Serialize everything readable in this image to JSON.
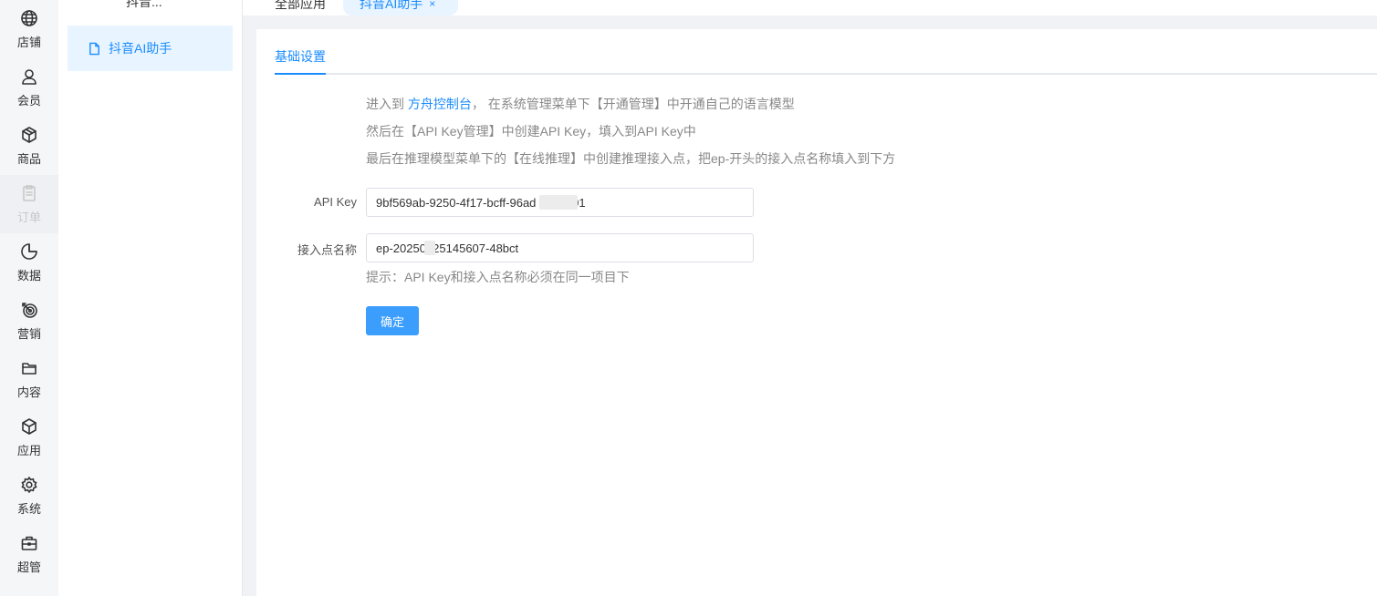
{
  "rail": {
    "items": [
      {
        "label": "店铺",
        "icon": "globe-icon"
      },
      {
        "label": "会员",
        "icon": "user-icon"
      },
      {
        "label": "商品",
        "icon": "box-icon"
      },
      {
        "label": "订单",
        "icon": "clipboard-icon"
      },
      {
        "label": "数据",
        "icon": "pie-chart-icon"
      },
      {
        "label": "营销",
        "icon": "target-icon"
      },
      {
        "label": "内容",
        "icon": "folder-icon"
      },
      {
        "label": "应用",
        "icon": "cube-icon"
      },
      {
        "label": "系统",
        "icon": "gear-icon"
      },
      {
        "label": "超管",
        "icon": "briefcase-icon"
      }
    ]
  },
  "submenu": {
    "title": "抖音...",
    "item_label": "抖音AI助手",
    "item_icon": "document-icon"
  },
  "tabs": {
    "all_apps": "全部应用",
    "active": "抖音AI助手",
    "close_glyph": "×"
  },
  "subtabs": {
    "basic": "基础设置"
  },
  "instructions": {
    "line1_prefix": "进入到 ",
    "line1_link": "方舟控制台",
    "line1_suffix": "， 在系统管理菜单下【开通管理】中开通自己的语言模型",
    "line2": "然后在【API Key管理】中创建API Key，填入到API Key中",
    "line3": "最后在推理模型菜单下的【在线推理】中创建推理接入点，把ep-开头的接入点名称填入到下方"
  },
  "form": {
    "api_key_label": "API Key",
    "api_key_value": "9bf569ab-9250-4f17-bcff-96ad           01",
    "endpoint_label": "接入点名称",
    "endpoint_value": "ep-20250825145607-48bct",
    "hint": "提示：API Key和接入点名称必须在同一项目下",
    "submit_label": "确定"
  },
  "colors": {
    "accent": "#1a8cff",
    "button": "#3b9efc",
    "active_bg": "#e8f4ff",
    "muted_text": "#888888"
  }
}
